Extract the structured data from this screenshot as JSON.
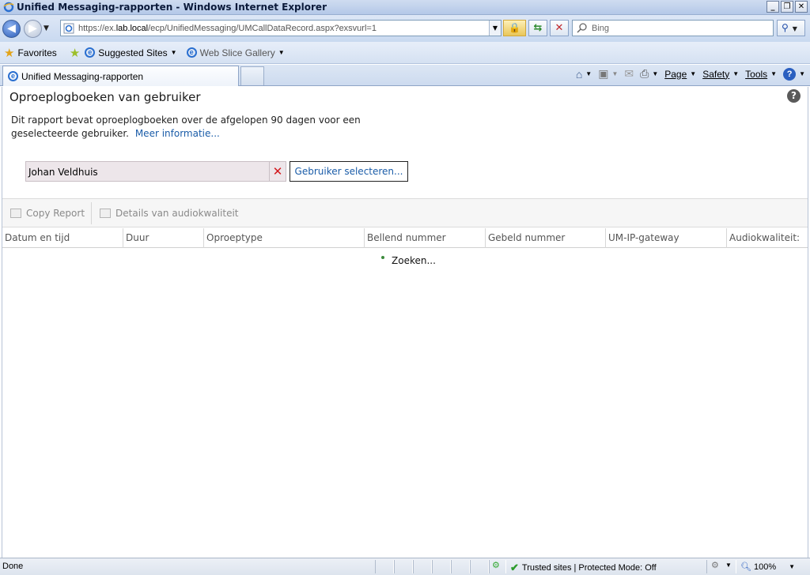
{
  "window": {
    "title": "Unified Messaging-rapporten - Windows Internet Explorer",
    "minimize": "_",
    "restore": "❐",
    "close": "✕"
  },
  "address": {
    "url_prefix": "https://ex.",
    "url_domain": "lab.local",
    "url_path": "/ecp/UnifiedMessaging/UMCallDataRecord.aspx?exsvurl=1"
  },
  "search": {
    "placeholder": "Bing"
  },
  "favorites": {
    "favorites_label": "Favorites",
    "suggested_sites": "Suggested Sites",
    "web_slice_gallery": "Web Slice Gallery"
  },
  "tabs": {
    "active_label": "Unified Messaging-rapporten"
  },
  "commandbar": {
    "page": "Page",
    "safety": "Safety",
    "tools": "Tools"
  },
  "page": {
    "title": "Oproeplogboeken van gebruiker",
    "description": "Dit rapport bevat oproeplogboeken over de afgelopen 90 dagen voor een geselecteerde gebruiker.",
    "more_info": "Meer informatie...",
    "user_value": "Johan Veldhuis",
    "select_user_button": "Gebruiker selecteren...",
    "toolbar": {
      "copy_report": "Copy Report",
      "audio_details": "Details van audiokwaliteit"
    },
    "columns": [
      "Datum en tijd",
      "Duur",
      "Oproeptype",
      "Bellend nummer",
      "Gebeld nummer",
      "UM-IP-gateway",
      "Audiokwaliteit:"
    ],
    "searching": "Zoeken..."
  },
  "statusbar": {
    "status": "Done",
    "zone": "Trusted sites | Protected Mode: Off",
    "zoom": "100%"
  },
  "colors": {
    "link": "#1a5ca8",
    "clear_icon": "#d2161b",
    "user_field_bg": "#ede6ea"
  }
}
